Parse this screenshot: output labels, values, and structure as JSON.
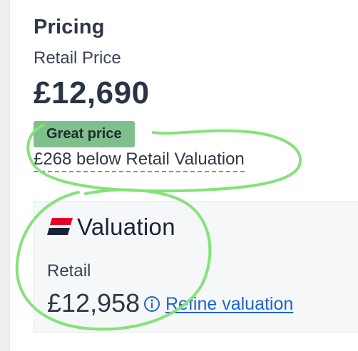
{
  "pricing": {
    "title": "Pricing",
    "retail_price_label": "Retail Price",
    "retail_price_value": "£12,690",
    "badge_label": "Great price",
    "below_text": "£268 below Retail Valuation"
  },
  "valuation": {
    "brand_name": "Valuation",
    "retail_label": "Retail",
    "retail_value": "£12,958",
    "info_icon": "info-circle-icon",
    "refine_link": "Refine valuation"
  },
  "colors": {
    "badge_green": "#7fbf8d",
    "link_blue": "#1f64c8",
    "annotation_green": "#86e27a",
    "logo_red": "#e4002b",
    "logo_navy": "#1c2236"
  }
}
